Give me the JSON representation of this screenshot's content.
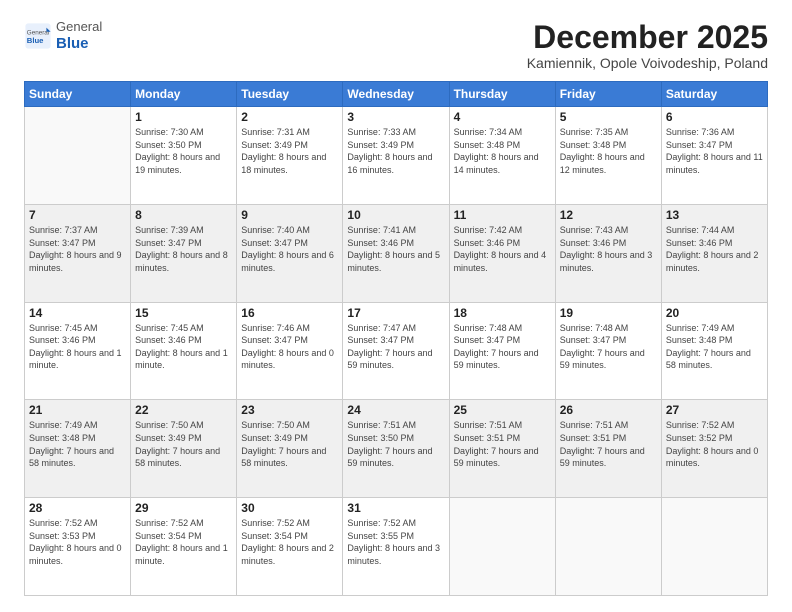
{
  "logo": {
    "general": "General",
    "blue": "Blue"
  },
  "header": {
    "month": "December 2025",
    "location": "Kamiennik, Opole Voivodeship, Poland"
  },
  "weekdays": [
    "Sunday",
    "Monday",
    "Tuesday",
    "Wednesday",
    "Thursday",
    "Friday",
    "Saturday"
  ],
  "weeks": [
    [
      {
        "day": "",
        "empty": true
      },
      {
        "day": "1",
        "sunrise": "7:30 AM",
        "sunset": "3:50 PM",
        "daylight": "8 hours and 19 minutes."
      },
      {
        "day": "2",
        "sunrise": "7:31 AM",
        "sunset": "3:49 PM",
        "daylight": "8 hours and 18 minutes."
      },
      {
        "day": "3",
        "sunrise": "7:33 AM",
        "sunset": "3:49 PM",
        "daylight": "8 hours and 16 minutes."
      },
      {
        "day": "4",
        "sunrise": "7:34 AM",
        "sunset": "3:48 PM",
        "daylight": "8 hours and 14 minutes."
      },
      {
        "day": "5",
        "sunrise": "7:35 AM",
        "sunset": "3:48 PM",
        "daylight": "8 hours and 12 minutes."
      },
      {
        "day": "6",
        "sunrise": "7:36 AM",
        "sunset": "3:47 PM",
        "daylight": "8 hours and 11 minutes."
      }
    ],
    [
      {
        "day": "7",
        "sunrise": "7:37 AM",
        "sunset": "3:47 PM",
        "daylight": "8 hours and 9 minutes."
      },
      {
        "day": "8",
        "sunrise": "7:39 AM",
        "sunset": "3:47 PM",
        "daylight": "8 hours and 8 minutes."
      },
      {
        "day": "9",
        "sunrise": "7:40 AM",
        "sunset": "3:47 PM",
        "daylight": "8 hours and 6 minutes."
      },
      {
        "day": "10",
        "sunrise": "7:41 AM",
        "sunset": "3:46 PM",
        "daylight": "8 hours and 5 minutes."
      },
      {
        "day": "11",
        "sunrise": "7:42 AM",
        "sunset": "3:46 PM",
        "daylight": "8 hours and 4 minutes."
      },
      {
        "day": "12",
        "sunrise": "7:43 AM",
        "sunset": "3:46 PM",
        "daylight": "8 hours and 3 minutes."
      },
      {
        "day": "13",
        "sunrise": "7:44 AM",
        "sunset": "3:46 PM",
        "daylight": "8 hours and 2 minutes."
      }
    ],
    [
      {
        "day": "14",
        "sunrise": "7:45 AM",
        "sunset": "3:46 PM",
        "daylight": "8 hours and 1 minute."
      },
      {
        "day": "15",
        "sunrise": "7:45 AM",
        "sunset": "3:46 PM",
        "daylight": "8 hours and 1 minute."
      },
      {
        "day": "16",
        "sunrise": "7:46 AM",
        "sunset": "3:47 PM",
        "daylight": "8 hours and 0 minutes."
      },
      {
        "day": "17",
        "sunrise": "7:47 AM",
        "sunset": "3:47 PM",
        "daylight": "7 hours and 59 minutes."
      },
      {
        "day": "18",
        "sunrise": "7:48 AM",
        "sunset": "3:47 PM",
        "daylight": "7 hours and 59 minutes."
      },
      {
        "day": "19",
        "sunrise": "7:48 AM",
        "sunset": "3:47 PM",
        "daylight": "7 hours and 59 minutes."
      },
      {
        "day": "20",
        "sunrise": "7:49 AM",
        "sunset": "3:48 PM",
        "daylight": "7 hours and 58 minutes."
      }
    ],
    [
      {
        "day": "21",
        "sunrise": "7:49 AM",
        "sunset": "3:48 PM",
        "daylight": "7 hours and 58 minutes."
      },
      {
        "day": "22",
        "sunrise": "7:50 AM",
        "sunset": "3:49 PM",
        "daylight": "7 hours and 58 minutes."
      },
      {
        "day": "23",
        "sunrise": "7:50 AM",
        "sunset": "3:49 PM",
        "daylight": "7 hours and 58 minutes."
      },
      {
        "day": "24",
        "sunrise": "7:51 AM",
        "sunset": "3:50 PM",
        "daylight": "7 hours and 59 minutes."
      },
      {
        "day": "25",
        "sunrise": "7:51 AM",
        "sunset": "3:51 PM",
        "daylight": "7 hours and 59 minutes."
      },
      {
        "day": "26",
        "sunrise": "7:51 AM",
        "sunset": "3:51 PM",
        "daylight": "7 hours and 59 minutes."
      },
      {
        "day": "27",
        "sunrise": "7:52 AM",
        "sunset": "3:52 PM",
        "daylight": "8 hours and 0 minutes."
      }
    ],
    [
      {
        "day": "28",
        "sunrise": "7:52 AM",
        "sunset": "3:53 PM",
        "daylight": "8 hours and 0 minutes."
      },
      {
        "day": "29",
        "sunrise": "7:52 AM",
        "sunset": "3:54 PM",
        "daylight": "8 hours and 1 minute."
      },
      {
        "day": "30",
        "sunrise": "7:52 AM",
        "sunset": "3:54 PM",
        "daylight": "8 hours and 2 minutes."
      },
      {
        "day": "31",
        "sunrise": "7:52 AM",
        "sunset": "3:55 PM",
        "daylight": "8 hours and 3 minutes."
      },
      {
        "day": "",
        "empty": true
      },
      {
        "day": "",
        "empty": true
      },
      {
        "day": "",
        "empty": true
      }
    ]
  ],
  "labels": {
    "sunrise": "Sunrise:",
    "sunset": "Sunset:",
    "daylight": "Daylight:"
  }
}
